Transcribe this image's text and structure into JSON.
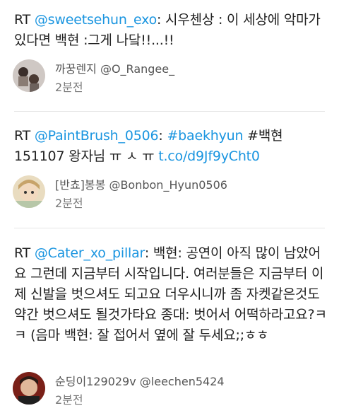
{
  "tweets": [
    {
      "rt": "RT ",
      "mention": "@sweetsehun_exo",
      "text_after_mention": ": 시우첸상 : 이 세상에 악마가 있다면 백현 :그게 나닼!!...!!",
      "author": "까꿍렌지 @O_Rangee_",
      "time": "2분전"
    },
    {
      "rt": "RT ",
      "mention": "@PaintBrush_0506",
      "colon": ": ",
      "hashtag1": "#baekhyun",
      "text_mid": " #백현 151107 왕자님 ㅠ ㅅ ㅠ ",
      "link": "t.co/d9Jf9yCht0",
      "author": "[반쵸]봉봉 @Bonbon_Hyun0506",
      "time": "2분전"
    },
    {
      "rt": "RT ",
      "mention": "@Cater_xo_pillar",
      "text_after_mention": ": 백현: 공연이 아직 많이 남았어요 그런데 지금부터 시작입니다. 여러분들은 지금부터 이제 신발을 벗으셔도 되고요 더우시니까 좀 자켓같은것도 약간 벗으셔도 될것가타요 종대: 벗어서 어떡하라고요?ㅋㅋ (음마 백현: 잘 접어서 옆에 잘 두세요;;ㅎㅎ",
      "author": "순딩이129029v @leechen5424",
      "time": "2분전"
    }
  ]
}
